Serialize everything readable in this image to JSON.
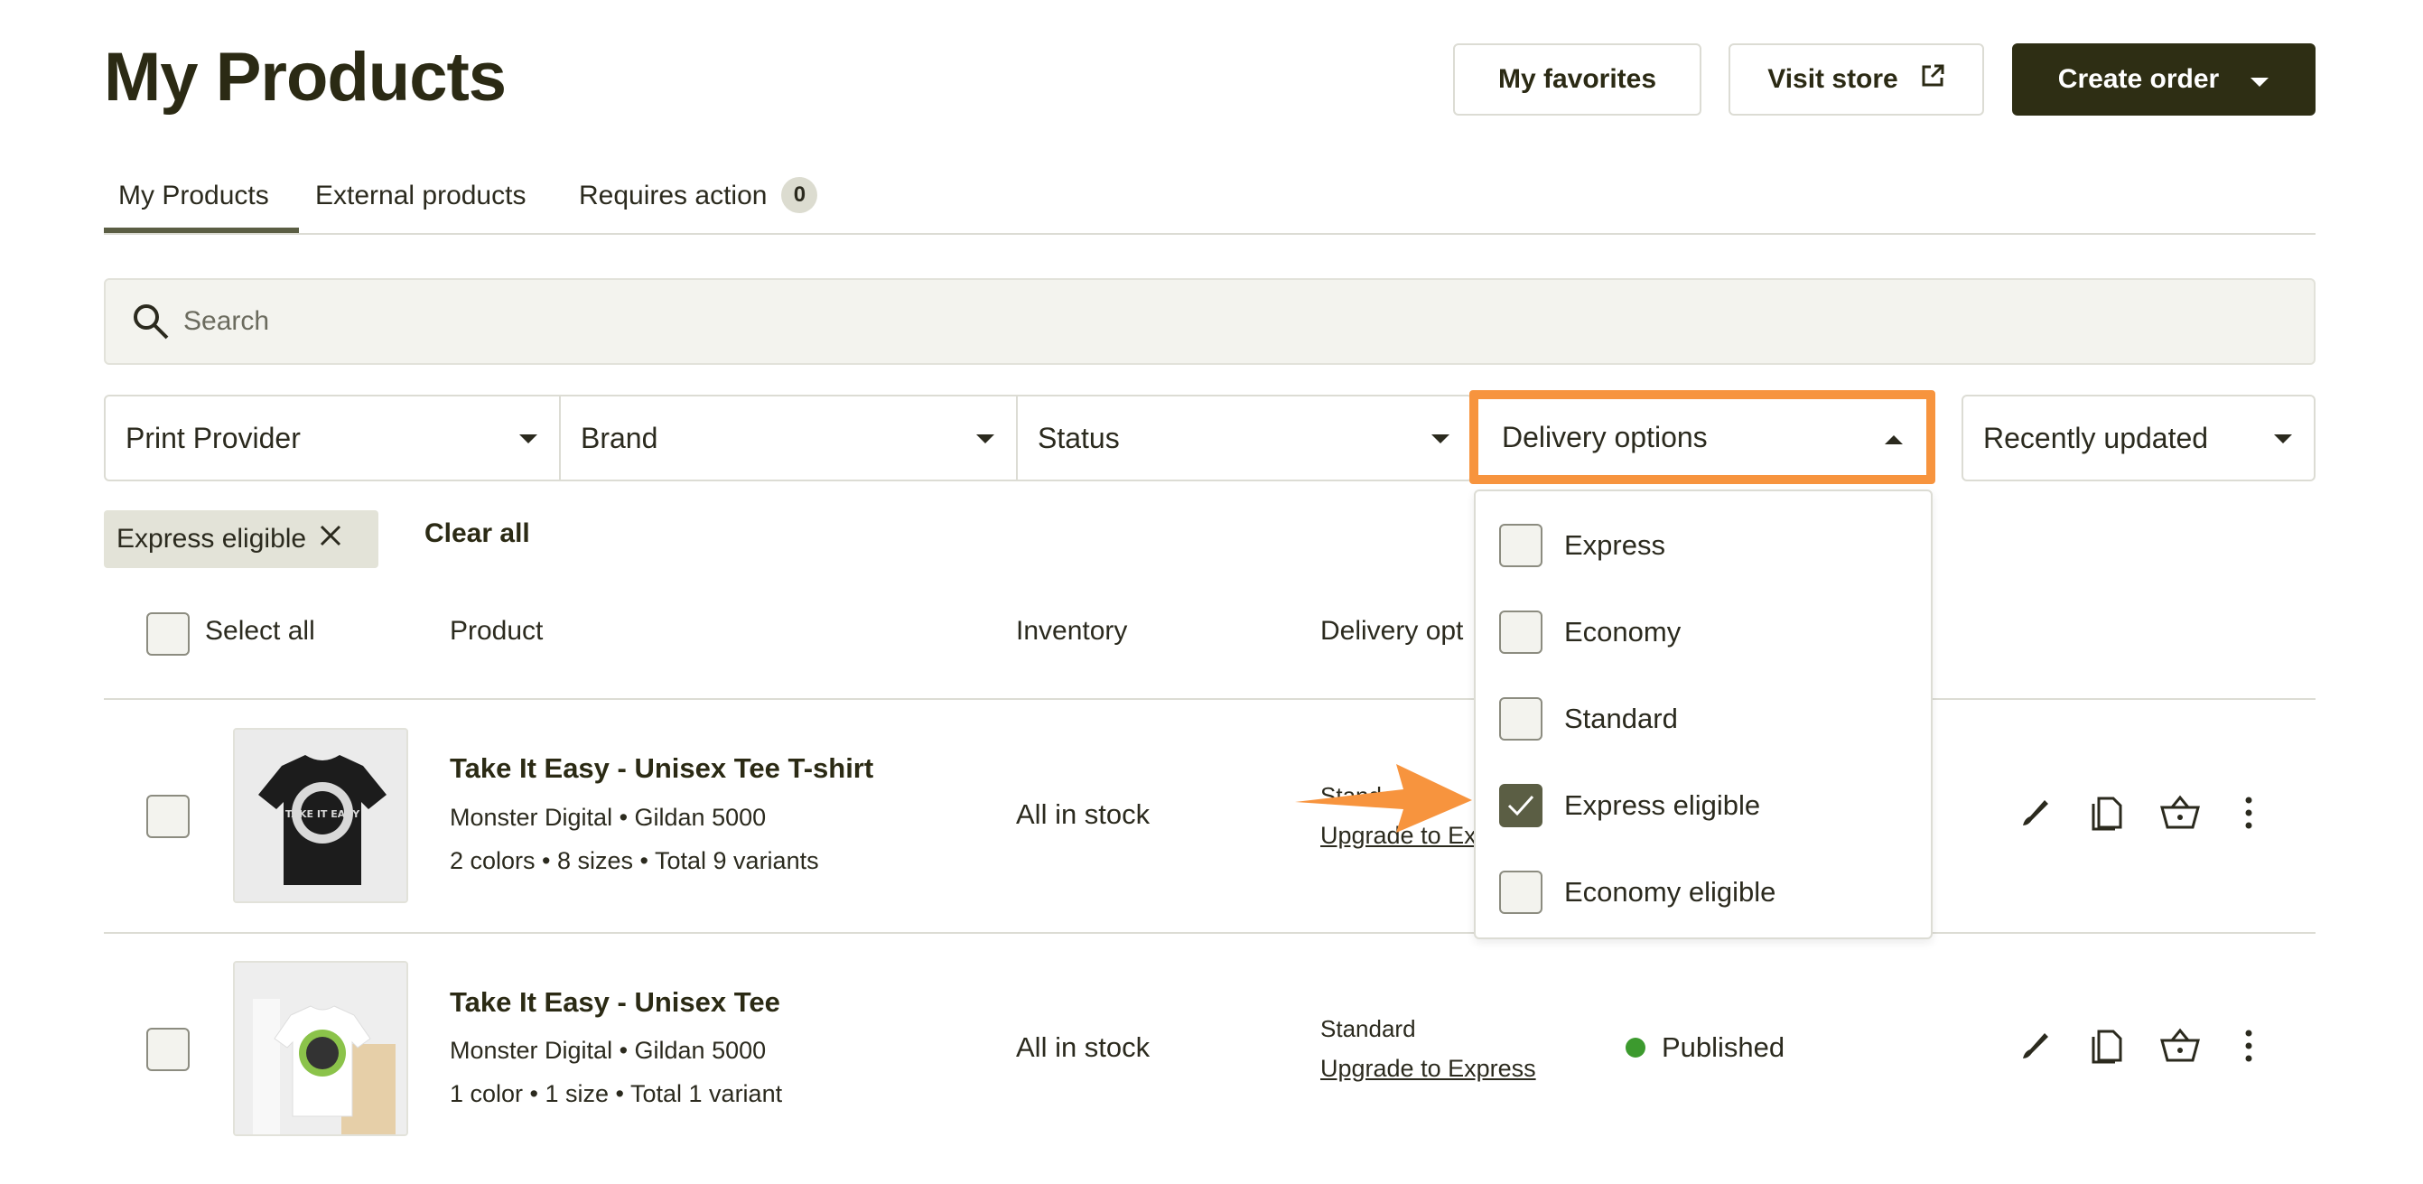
{
  "page": {
    "title": "My Products"
  },
  "header_buttons": {
    "favorites": "My favorites",
    "visit_store": "Visit store",
    "create_order": "Create order"
  },
  "tabs": [
    {
      "label": "My Products",
      "active": true
    },
    {
      "label": "External products",
      "active": false
    },
    {
      "label": "Requires action",
      "active": false,
      "count": "0"
    }
  ],
  "search": {
    "placeholder": "Search"
  },
  "filters": {
    "print_provider": "Print Provider",
    "brand": "Brand",
    "status": "Status",
    "delivery_options": "Delivery options",
    "sort": "Recently updated"
  },
  "active_filters": {
    "chip": "Express eligible",
    "clear_all": "Clear all"
  },
  "table": {
    "select_all": "Select all",
    "headers": {
      "product": "Product",
      "inventory": "Inventory",
      "delivery": "Delivery opt"
    }
  },
  "products": [
    {
      "name": "Take It Easy - Unisex Tee T-shirt",
      "provider": "Monster Digital • Gildan 5000",
      "variants": "2 colors • 8 sizes • Total 9 variants",
      "inventory": "All in stock",
      "delivery": "Standard",
      "upgrade": "Upgrade to Express",
      "status": ""
    },
    {
      "name": "Take It Easy - Unisex Tee",
      "provider": "Monster Digital • Gildan 5000",
      "variants": "1 color • 1 size • Total 1 variant",
      "inventory": "All in stock",
      "delivery": "Standard",
      "upgrade": "Upgrade to Express",
      "status": "Published"
    }
  ],
  "delivery_dropdown": {
    "options": [
      {
        "label": "Express",
        "checked": false
      },
      {
        "label": "Economy",
        "checked": false
      },
      {
        "label": "Standard",
        "checked": false
      },
      {
        "label": "Express eligible",
        "checked": true
      },
      {
        "label": "Economy eligible",
        "checked": false
      }
    ]
  },
  "thumb_text": "TAKE IT EASY",
  "colors": {
    "accent": "#f7943e",
    "primary": "#2e2e14",
    "published": "#3c9a2e",
    "tab_underline": "#5b5e44"
  }
}
